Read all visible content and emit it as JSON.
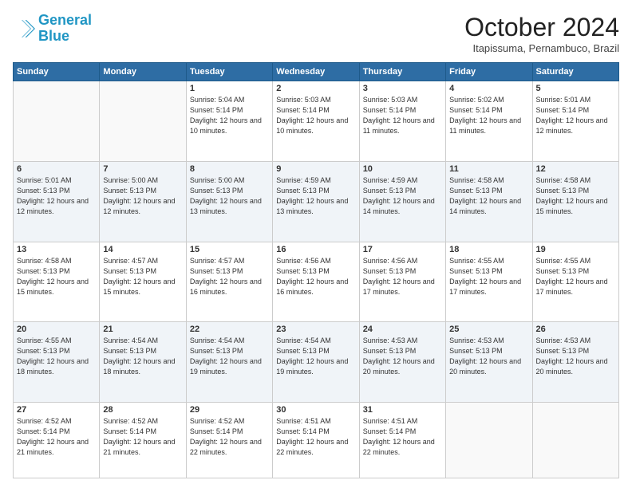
{
  "header": {
    "logo_line1": "General",
    "logo_line2": "Blue",
    "month_title": "October 2024",
    "location": "Itapissuma, Pernambuco, Brazil"
  },
  "weekdays": [
    "Sunday",
    "Monday",
    "Tuesday",
    "Wednesday",
    "Thursday",
    "Friday",
    "Saturday"
  ],
  "weeks": [
    [
      {
        "day": "",
        "info": ""
      },
      {
        "day": "",
        "info": ""
      },
      {
        "day": "1",
        "info": "Sunrise: 5:04 AM\nSunset: 5:14 PM\nDaylight: 12 hours\nand 10 minutes."
      },
      {
        "day": "2",
        "info": "Sunrise: 5:03 AM\nSunset: 5:14 PM\nDaylight: 12 hours\nand 10 minutes."
      },
      {
        "day": "3",
        "info": "Sunrise: 5:03 AM\nSunset: 5:14 PM\nDaylight: 12 hours\nand 11 minutes."
      },
      {
        "day": "4",
        "info": "Sunrise: 5:02 AM\nSunset: 5:14 PM\nDaylight: 12 hours\nand 11 minutes."
      },
      {
        "day": "5",
        "info": "Sunrise: 5:01 AM\nSunset: 5:14 PM\nDaylight: 12 hours\nand 12 minutes."
      }
    ],
    [
      {
        "day": "6",
        "info": "Sunrise: 5:01 AM\nSunset: 5:13 PM\nDaylight: 12 hours\nand 12 minutes."
      },
      {
        "day": "7",
        "info": "Sunrise: 5:00 AM\nSunset: 5:13 PM\nDaylight: 12 hours\nand 12 minutes."
      },
      {
        "day": "8",
        "info": "Sunrise: 5:00 AM\nSunset: 5:13 PM\nDaylight: 12 hours\nand 13 minutes."
      },
      {
        "day": "9",
        "info": "Sunrise: 4:59 AM\nSunset: 5:13 PM\nDaylight: 12 hours\nand 13 minutes."
      },
      {
        "day": "10",
        "info": "Sunrise: 4:59 AM\nSunset: 5:13 PM\nDaylight: 12 hours\nand 14 minutes."
      },
      {
        "day": "11",
        "info": "Sunrise: 4:58 AM\nSunset: 5:13 PM\nDaylight: 12 hours\nand 14 minutes."
      },
      {
        "day": "12",
        "info": "Sunrise: 4:58 AM\nSunset: 5:13 PM\nDaylight: 12 hours\nand 15 minutes."
      }
    ],
    [
      {
        "day": "13",
        "info": "Sunrise: 4:58 AM\nSunset: 5:13 PM\nDaylight: 12 hours\nand 15 minutes."
      },
      {
        "day": "14",
        "info": "Sunrise: 4:57 AM\nSunset: 5:13 PM\nDaylight: 12 hours\nand 15 minutes."
      },
      {
        "day": "15",
        "info": "Sunrise: 4:57 AM\nSunset: 5:13 PM\nDaylight: 12 hours\nand 16 minutes."
      },
      {
        "day": "16",
        "info": "Sunrise: 4:56 AM\nSunset: 5:13 PM\nDaylight: 12 hours\nand 16 minutes."
      },
      {
        "day": "17",
        "info": "Sunrise: 4:56 AM\nSunset: 5:13 PM\nDaylight: 12 hours\nand 17 minutes."
      },
      {
        "day": "18",
        "info": "Sunrise: 4:55 AM\nSunset: 5:13 PM\nDaylight: 12 hours\nand 17 minutes."
      },
      {
        "day": "19",
        "info": "Sunrise: 4:55 AM\nSunset: 5:13 PM\nDaylight: 12 hours\nand 17 minutes."
      }
    ],
    [
      {
        "day": "20",
        "info": "Sunrise: 4:55 AM\nSunset: 5:13 PM\nDaylight: 12 hours\nand 18 minutes."
      },
      {
        "day": "21",
        "info": "Sunrise: 4:54 AM\nSunset: 5:13 PM\nDaylight: 12 hours\nand 18 minutes."
      },
      {
        "day": "22",
        "info": "Sunrise: 4:54 AM\nSunset: 5:13 PM\nDaylight: 12 hours\nand 19 minutes."
      },
      {
        "day": "23",
        "info": "Sunrise: 4:54 AM\nSunset: 5:13 PM\nDaylight: 12 hours\nand 19 minutes."
      },
      {
        "day": "24",
        "info": "Sunrise: 4:53 AM\nSunset: 5:13 PM\nDaylight: 12 hours\nand 20 minutes."
      },
      {
        "day": "25",
        "info": "Sunrise: 4:53 AM\nSunset: 5:13 PM\nDaylight: 12 hours\nand 20 minutes."
      },
      {
        "day": "26",
        "info": "Sunrise: 4:53 AM\nSunset: 5:13 PM\nDaylight: 12 hours\nand 20 minutes."
      }
    ],
    [
      {
        "day": "27",
        "info": "Sunrise: 4:52 AM\nSunset: 5:14 PM\nDaylight: 12 hours\nand 21 minutes."
      },
      {
        "day": "28",
        "info": "Sunrise: 4:52 AM\nSunset: 5:14 PM\nDaylight: 12 hours\nand 21 minutes."
      },
      {
        "day": "29",
        "info": "Sunrise: 4:52 AM\nSunset: 5:14 PM\nDaylight: 12 hours\nand 22 minutes."
      },
      {
        "day": "30",
        "info": "Sunrise: 4:51 AM\nSunset: 5:14 PM\nDaylight: 12 hours\nand 22 minutes."
      },
      {
        "day": "31",
        "info": "Sunrise: 4:51 AM\nSunset: 5:14 PM\nDaylight: 12 hours\nand 22 minutes."
      },
      {
        "day": "",
        "info": ""
      },
      {
        "day": "",
        "info": ""
      }
    ]
  ]
}
